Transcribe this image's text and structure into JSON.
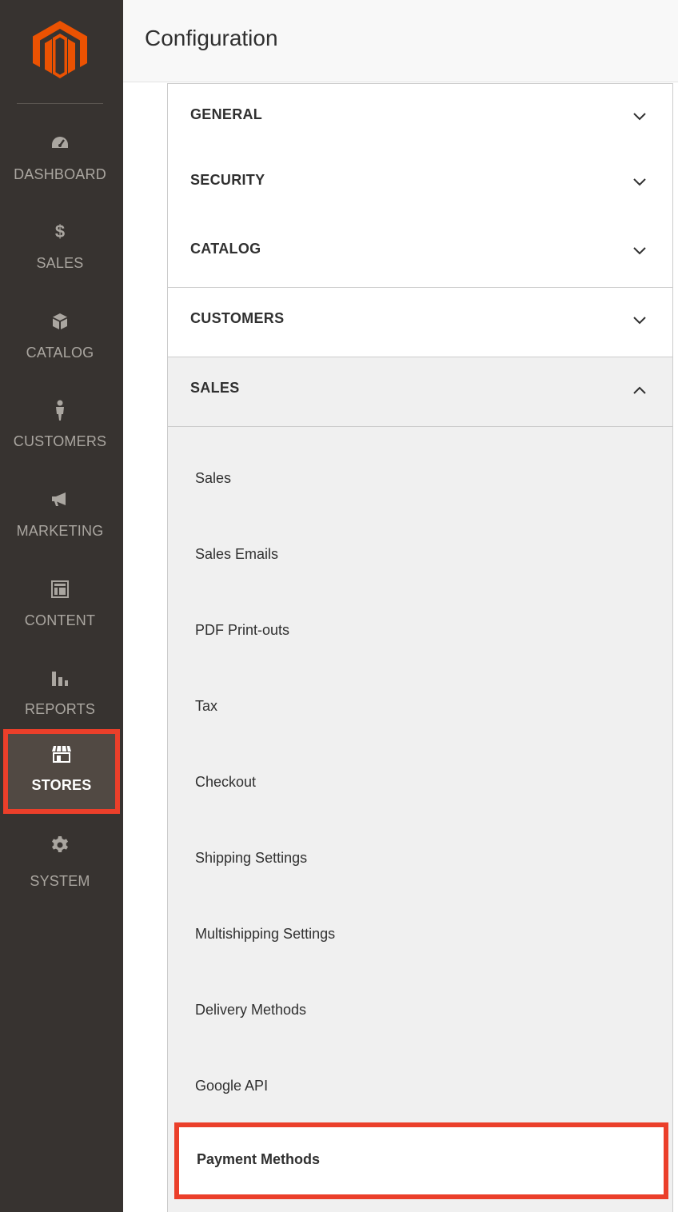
{
  "header": {
    "title": "Configuration"
  },
  "nav": {
    "items": [
      {
        "label": "DASHBOARD",
        "icon": "dashboard-icon"
      },
      {
        "label": "SALES",
        "icon": "dollar-icon"
      },
      {
        "label": "CATALOG",
        "icon": "box-icon"
      },
      {
        "label": "CUSTOMERS",
        "icon": "person-icon"
      },
      {
        "label": "MARKETING",
        "icon": "megaphone-icon"
      },
      {
        "label": "CONTENT",
        "icon": "layout-icon"
      },
      {
        "label": "REPORTS",
        "icon": "bar-chart-icon"
      },
      {
        "label": "STORES",
        "icon": "storefront-icon",
        "active": true
      },
      {
        "label": "SYSTEM",
        "icon": "gear-icon"
      }
    ]
  },
  "sections": [
    {
      "title": "GENERAL",
      "expanded": false
    },
    {
      "title": "SECURITY",
      "expanded": false
    },
    {
      "title": "CATALOG",
      "expanded": false
    },
    {
      "title": "CUSTOMERS",
      "expanded": false
    },
    {
      "title": "SALES",
      "expanded": true
    }
  ],
  "sales_items": [
    "Sales",
    "Sales Emails",
    "PDF Print-outs",
    "Tax",
    "Checkout",
    "Shipping Settings",
    "Multishipping Settings",
    "Delivery Methods",
    "Google API",
    "Payment Methods"
  ],
  "colors": {
    "nav_bg": "#373330",
    "logo": "#eb5202",
    "highlight": "#eb3f2a"
  }
}
